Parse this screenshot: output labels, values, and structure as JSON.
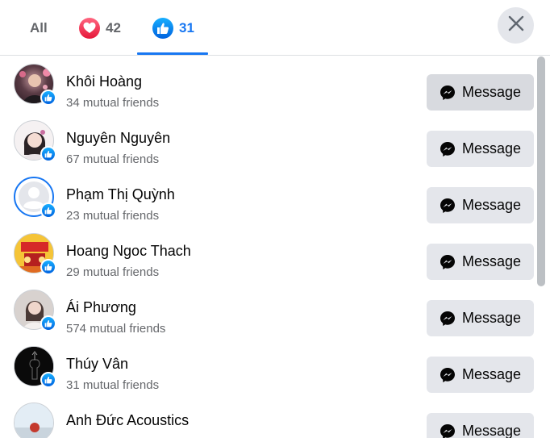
{
  "tabs": {
    "all_label": "All",
    "love_count": "42",
    "like_count": "31"
  },
  "people": [
    {
      "name": "Khôi Hoàng",
      "mutual": "34 mutual friends",
      "button": "Message"
    },
    {
      "name": "Nguyên Nguyên",
      "mutual": "67 mutual friends",
      "button": "Message"
    },
    {
      "name": "Phạm Thị Quỳnh",
      "mutual": "23 mutual friends",
      "button": "Message"
    },
    {
      "name": "Hoang Ngoc Thach",
      "mutual": "29 mutual friends",
      "button": "Message"
    },
    {
      "name": "Ái Phương",
      "mutual": "574 mutual friends",
      "button": "Message"
    },
    {
      "name": "Thúy Vân",
      "mutual": "31 mutual friends",
      "button": "Message"
    },
    {
      "name": "Anh Đức Acoustics",
      "mutual": "",
      "button": "Message"
    }
  ],
  "colors": {
    "accent": "#1877f2",
    "love": "#f33e58",
    "button_bg": "#e4e6eb",
    "secondary_text": "#65676b"
  },
  "icons": {
    "love": "heart-icon",
    "like": "thumbs-up-icon",
    "close": "close-icon",
    "message": "messenger-icon"
  }
}
